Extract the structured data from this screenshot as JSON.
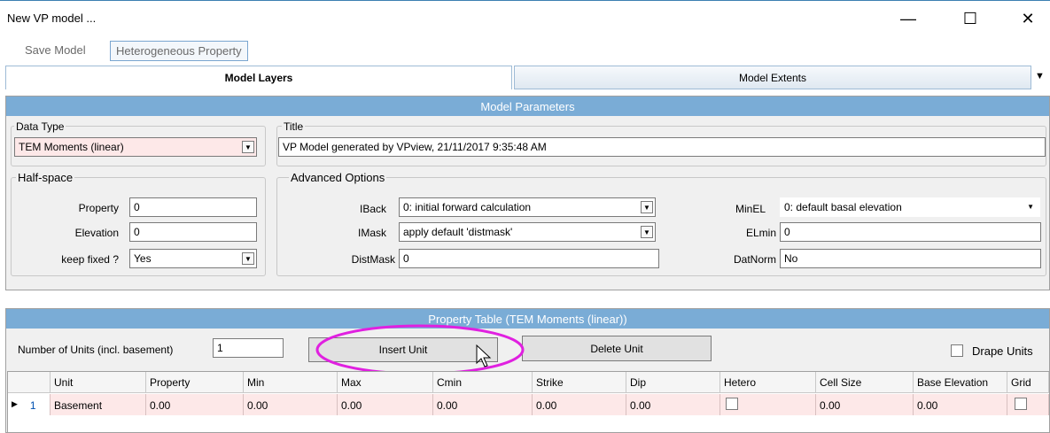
{
  "window": {
    "title": "New VP model ...",
    "minimize": "—",
    "maximize": "☐",
    "close": "✕"
  },
  "menu": {
    "save_model": "Save Model",
    "heterogeneous": "Heterogeneous Property"
  },
  "tabs": {
    "model_layers": "Model Layers",
    "model_extents": "Model Extents",
    "overflow": "▼"
  },
  "model_params": {
    "header": "Model Parameters",
    "data_type_label": "Data Type",
    "data_type_value": "TEM Moments (linear)",
    "title_label": "Title",
    "title_value": "VP Model generated by VPview, 21/11/2017 9:35:48 AM"
  },
  "half_space": {
    "label": "Half-space",
    "property_label": "Property",
    "property_value": "0",
    "elevation_label": "Elevation",
    "elevation_value": "0",
    "keep_fixed_label": "keep fixed ?",
    "keep_fixed_value": "Yes"
  },
  "advanced": {
    "label": "Advanced Options",
    "iback_label": "IBack",
    "iback_value": "0: initial forward calculation",
    "imask_label": "IMask",
    "imask_value": "apply default 'distmask'",
    "distmask_label": "DistMask",
    "distmask_value": "0",
    "minel_label": "MinEL",
    "minel_value": "0: default basal elevation",
    "elmin_label": "ELmin",
    "elmin_value": "0",
    "datnorm_label": "DatNorm",
    "datnorm_value": "No"
  },
  "property_table": {
    "header": "Property Table (TEM Moments (linear))",
    "num_units_label": "Number of Units (incl. basement)",
    "num_units_value": "1",
    "insert_unit": "Insert Unit",
    "delete_unit": "Delete Unit",
    "drape_units": "Drape Units",
    "columns": [
      "Unit",
      "Property",
      "Min",
      "Max",
      "Cmin",
      "Strike",
      "Dip",
      "Hetero",
      "Cell Size",
      "Base Elevation",
      "Grid"
    ],
    "rows": [
      {
        "index": "1",
        "unit": "Basement",
        "property": "0.00",
        "min": "0.00",
        "max": "0.00",
        "cmin": "0.00",
        "strike": "0.00",
        "dip": "0.00",
        "cell_size": "0.00",
        "base_elevation": "0.00"
      }
    ]
  },
  "icons": {
    "row_pointer": "▶",
    "combo_arrow": "▼"
  },
  "colors": {
    "header_blue": "#7aacd6",
    "highlight_magenta": "#e020e0",
    "row_pink": "#fde8e8"
  }
}
